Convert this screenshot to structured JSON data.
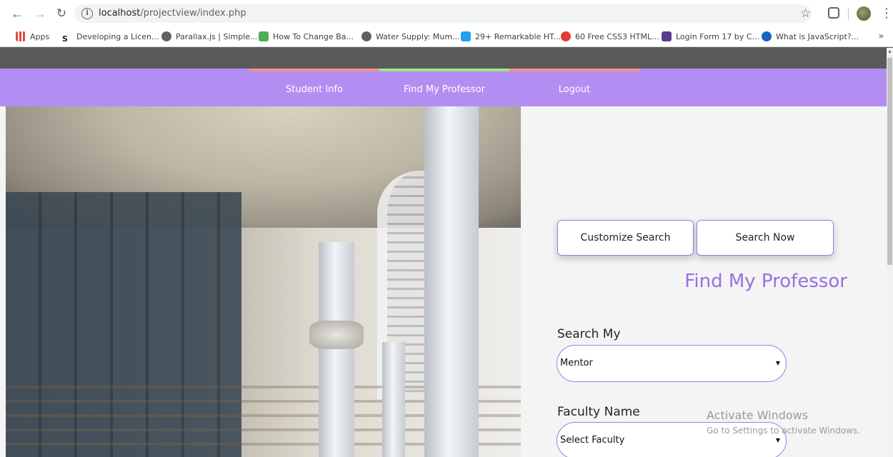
{
  "browser": {
    "url_host": "localhost",
    "url_path": "/projectview/index.php",
    "bookmarks": [
      {
        "label": "Apps",
        "icon": "apps-grid-icon",
        "color": "#e8453c"
      },
      {
        "label": "Developing a Licen...",
        "icon": "s-favicon",
        "color": "#202124"
      },
      {
        "label": "Parallax.js | Simple...",
        "icon": "globe-icon",
        "color": "#5f6368"
      },
      {
        "label": "How To Change Ba...",
        "icon": "w3-favicon",
        "color": "#4caf50"
      },
      {
        "label": "Water Supply: Mum...",
        "icon": "globe-icon",
        "color": "#5f6368"
      },
      {
        "label": "29+ Remarkable HT...",
        "icon": "t-favicon",
        "color": "#1da1f2"
      },
      {
        "label": "60 Free CSS3 HTML...",
        "icon": "circle-favicon",
        "color": "#e53935"
      },
      {
        "label": "Login Form 17 by C...",
        "icon": "colorlib-favicon",
        "color": "#5c3c8c"
      },
      {
        "label": "What is JavaScript?...",
        "icon": "js-favicon",
        "color": "#1565c0"
      }
    ],
    "more_label": "»"
  },
  "nav": {
    "items": [
      {
        "label": "Student Info",
        "accent": "#f3928a"
      },
      {
        "label": "Find My Professor",
        "accent": "#a5e28f"
      },
      {
        "label": "Logout",
        "accent": "#f3928a"
      }
    ],
    "background": "#b38ef2"
  },
  "panel": {
    "customize_label": "Customize Search",
    "search_now_label": "Search Now",
    "title": "Find My Professor",
    "search_my_label": "Search My",
    "search_my_value": "Mentor",
    "faculty_label": "Faculty Name",
    "faculty_value": "Select Faculty",
    "accent": "#9a6fe0"
  },
  "watermark": {
    "line1": "Activate Windows",
    "line2": "Go to Settings to activate Windows."
  }
}
